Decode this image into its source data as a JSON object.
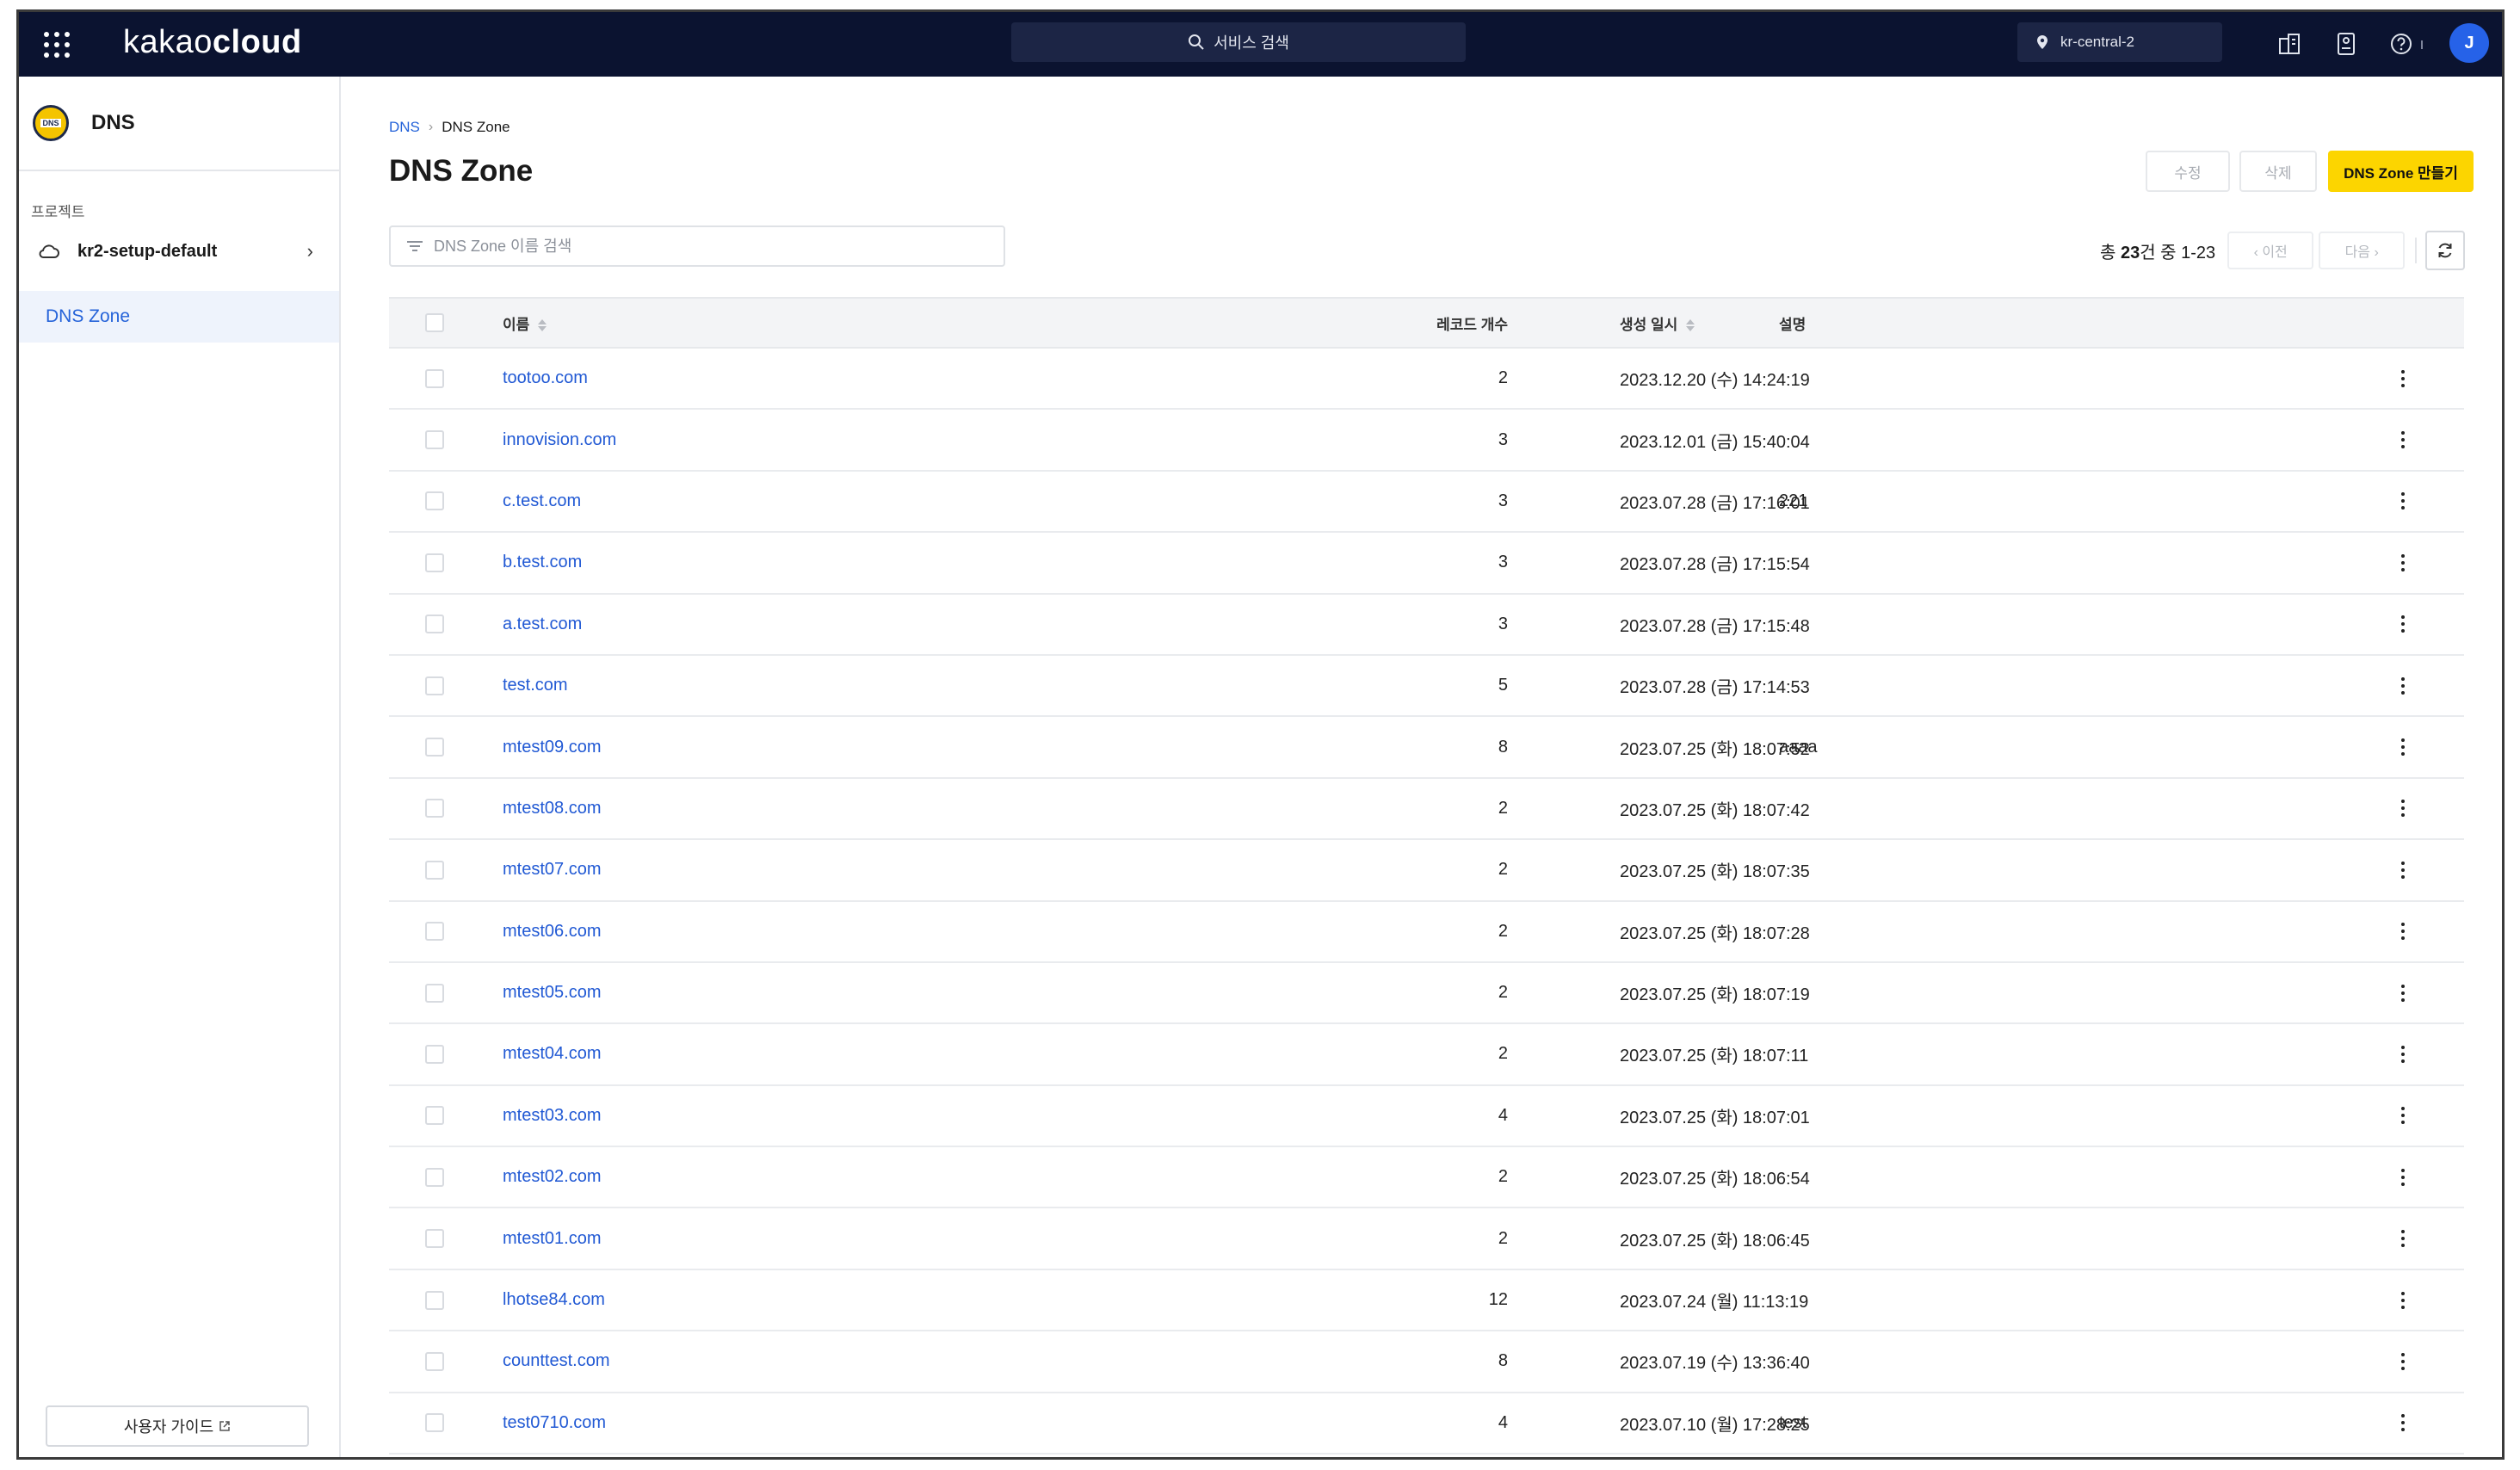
{
  "topbar": {
    "brand_prefix": "kakao",
    "brand_suffix": "cloud",
    "search_label": "서비스 검색",
    "region": "kr-central-2",
    "avatar_initial": "J"
  },
  "sidebar": {
    "service_title": "DNS",
    "logo_text": "DNS",
    "project_label": "프로젝트",
    "project_name": "kr2-setup-default",
    "project_arrow": "›",
    "nav_active": "DNS Zone",
    "guide_label": "사용자 가이드"
  },
  "main": {
    "breadcrumb": [
      "DNS",
      "DNS Zone"
    ],
    "title": "DNS Zone",
    "buttons": {
      "edit": "수정",
      "delete": "삭제",
      "create": "DNS Zone 만들기"
    },
    "filter_placeholder": "DNS Zone 이름 검색",
    "pager": {
      "prefix": "총 ",
      "total": "23",
      "suffix": "건 중 1-23",
      "prev": "‹  이전",
      "next": "다음  ›"
    },
    "columns": {
      "name": "이름",
      "records": "레코드 개수",
      "created": "생성 일시",
      "description": "설명"
    }
  },
  "rows": [
    {
      "name": "tootoo.com",
      "records": "2",
      "created": "2023.12.20 (수) 14:24:19",
      "description": ""
    },
    {
      "name": "innovision.com",
      "records": "3",
      "created": "2023.12.01 (금) 15:40:04",
      "description": ""
    },
    {
      "name": "c.test.com",
      "records": "3",
      "created": "2023.07.28 (금) 17:16:01",
      "description": "221"
    },
    {
      "name": "b.test.com",
      "records": "3",
      "created": "2023.07.28 (금) 17:15:54",
      "description": ""
    },
    {
      "name": "a.test.com",
      "records": "3",
      "created": "2023.07.28 (금) 17:15:48",
      "description": ""
    },
    {
      "name": "test.com",
      "records": "5",
      "created": "2023.07.28 (금) 17:14:53",
      "description": ""
    },
    {
      "name": "mtest09.com",
      "records": "8",
      "created": "2023.07.25 (화) 18:07:52",
      "description": "aaaa"
    },
    {
      "name": "mtest08.com",
      "records": "2",
      "created": "2023.07.25 (화) 18:07:42",
      "description": ""
    },
    {
      "name": "mtest07.com",
      "records": "2",
      "created": "2023.07.25 (화) 18:07:35",
      "description": ""
    },
    {
      "name": "mtest06.com",
      "records": "2",
      "created": "2023.07.25 (화) 18:07:28",
      "description": ""
    },
    {
      "name": "mtest05.com",
      "records": "2",
      "created": "2023.07.25 (화) 18:07:19",
      "description": ""
    },
    {
      "name": "mtest04.com",
      "records": "2",
      "created": "2023.07.25 (화) 18:07:11",
      "description": ""
    },
    {
      "name": "mtest03.com",
      "records": "4",
      "created": "2023.07.25 (화) 18:07:01",
      "description": ""
    },
    {
      "name": "mtest02.com",
      "records": "2",
      "created": "2023.07.25 (화) 18:06:54",
      "description": ""
    },
    {
      "name": "mtest01.com",
      "records": "2",
      "created": "2023.07.25 (화) 18:06:45",
      "description": ""
    },
    {
      "name": "lhotse84.com",
      "records": "12",
      "created": "2023.07.24 (월) 11:13:19",
      "description": ""
    },
    {
      "name": "counttest.com",
      "records": "8",
      "created": "2023.07.19 (수) 13:36:40",
      "description": ""
    },
    {
      "name": "test0710.com",
      "records": "4",
      "created": "2023.07.10 (월) 17:28:25",
      "description": "test"
    }
  ]
}
